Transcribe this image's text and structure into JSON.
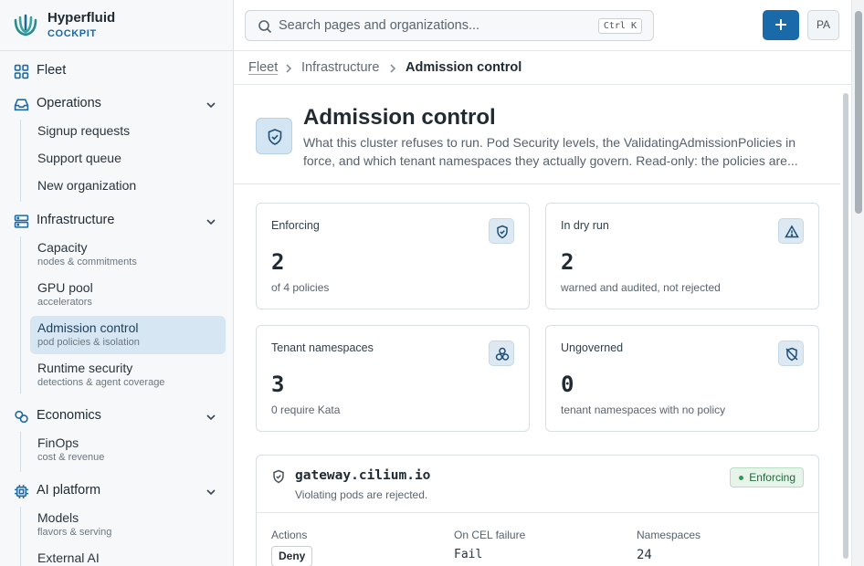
{
  "brand": {
    "name": "Hyperfluid",
    "sub": "COCKPIT"
  },
  "nav": {
    "fleet": "Fleet",
    "operations": {
      "label": "Operations",
      "items": [
        "Signup requests",
        "Support queue",
        "New organization"
      ]
    },
    "infrastructure": {
      "label": "Infrastructure",
      "items": [
        {
          "label": "Capacity",
          "hint": "nodes & commitments"
        },
        {
          "label": "GPU pool",
          "hint": "accelerators"
        },
        {
          "label": "Admission control",
          "hint": "pod policies & isolation"
        },
        {
          "label": "Runtime security",
          "hint": "detections & agent coverage"
        }
      ]
    },
    "economics": {
      "label": "Economics",
      "items": [
        {
          "label": "FinOps",
          "hint": "cost & revenue"
        }
      ]
    },
    "ai_platform": {
      "label": "AI platform",
      "items": [
        {
          "label": "Models",
          "hint": "flavors & serving"
        },
        {
          "label": "External AI",
          "hint": ""
        }
      ]
    }
  },
  "search": {
    "placeholder": "Search pages and organizations...",
    "shortcut": "Ctrl K"
  },
  "user": {
    "initials": "PA"
  },
  "breadcrumb": [
    "Fleet",
    "Infrastructure",
    "Admission control"
  ],
  "page": {
    "title": "Admission control",
    "description": "What this cluster refuses to run. Pod Security levels, the ValidatingAdmissionPolicies in force, and which tenant namespaces they actually govern. Read-only: the policies are..."
  },
  "stats": [
    {
      "label": "Enforcing",
      "value": "2",
      "caption": "of 4 policies",
      "icon": "shield-check-icon"
    },
    {
      "label": "In dry run",
      "value": "2",
      "caption": "warned and audited, not rejected",
      "icon": "warning-triangle-icon"
    },
    {
      "label": "Tenant namespaces",
      "value": "3",
      "caption": "0 require Kata",
      "icon": "cluster-icon"
    },
    {
      "label": "Ungoverned",
      "value": "0",
      "caption": "tenant namespaces with no policy",
      "icon": "shield-off-icon"
    }
  ],
  "policy": {
    "name": "gateway.cilium.io",
    "subtitle": "Violating pods are rejected.",
    "status": "Enforcing",
    "columns": [
      {
        "label": "Actions",
        "value": "Deny"
      },
      {
        "label": "On CEL failure",
        "value": "Fail"
      },
      {
        "label": "Namespaces",
        "value": "24"
      }
    ]
  },
  "colors": {
    "accent": "#1a6aa9",
    "active_nav": "#d6e6f2",
    "enforcing": "#2f9a57"
  }
}
